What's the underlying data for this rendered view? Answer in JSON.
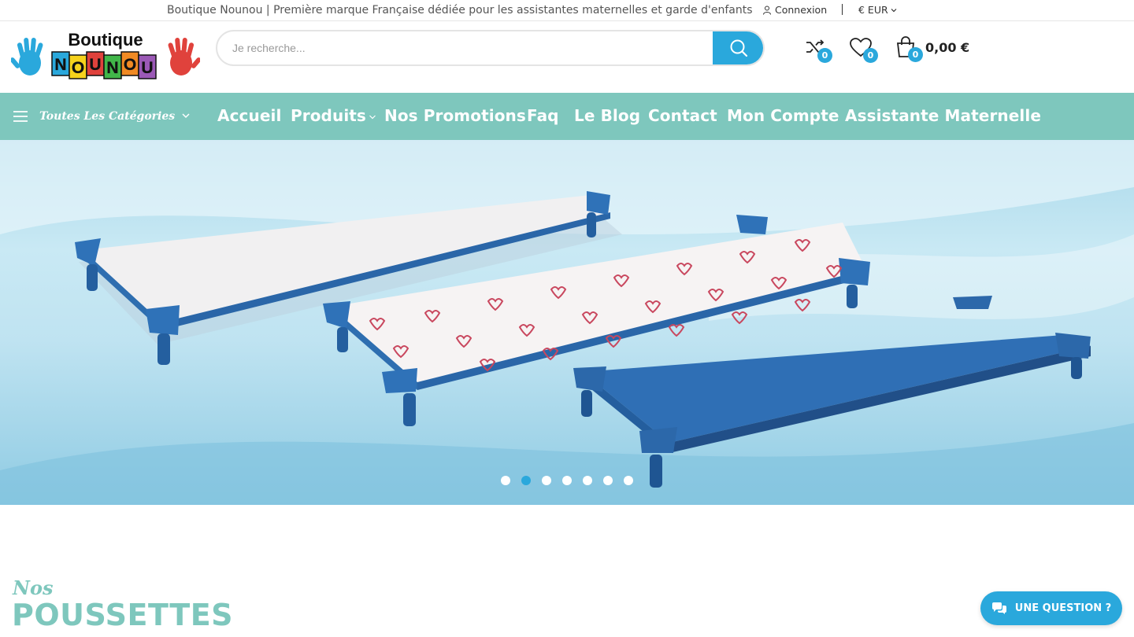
{
  "topbar": {
    "tagline": "Boutique Nounou | Première marque Française dédiée pour les assistantes maternelles et garde d'enfants",
    "login_label": "Connexion",
    "currency_label": "€ EUR"
  },
  "logo": {
    "line1": "Boutique",
    "letters": [
      "N",
      "O",
      "U",
      "N",
      "O",
      "U"
    ]
  },
  "search": {
    "placeholder": "Je recherche...",
    "value": ""
  },
  "header_icons": {
    "compare_count": "0",
    "wishlist_count": "0",
    "cart_count": "0",
    "cart_total": "0,00 €"
  },
  "nav": {
    "categories_label": "Toutes Les Catégories",
    "items": [
      {
        "label": "Accueil"
      },
      {
        "label": "Produits",
        "has_submenu": true
      },
      {
        "label": "Nos Promotions"
      },
      {
        "label": "Faq"
      },
      {
        "label": "Le Blog"
      },
      {
        "label": "Contact"
      },
      {
        "label": "Mon Compte"
      },
      {
        "label": "Assistante Maternelle"
      }
    ]
  },
  "slider": {
    "slide_count": 7,
    "active_index": 1
  },
  "section": {
    "small_title": "Nos",
    "big_title": "POUSSETTES"
  },
  "question_button": {
    "label": "UNE QUESTION ?"
  },
  "colors": {
    "accent_blue": "#2aa8dc",
    "nav_teal": "#7ec7bd"
  }
}
